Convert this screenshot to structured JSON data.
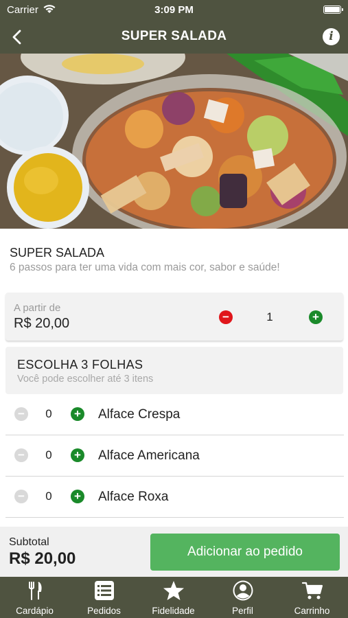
{
  "status_bar": {
    "carrier": "Carrier",
    "time": "3:09 PM"
  },
  "nav": {
    "title": "SUPER SALADA"
  },
  "product": {
    "name": "SUPER SALADA",
    "description": "6 passos para ter uma vida com mais cor, sabor e saúde!",
    "price_label": "A partir de",
    "price": "R$ 20,00",
    "quantity": "1"
  },
  "section": {
    "title": "ESCOLHA 3 FOLHAS",
    "subtitle": "Você pode escolher até 3 itens",
    "options": [
      {
        "label": "Alface Crespa",
        "qty": "0"
      },
      {
        "label": "Alface Americana",
        "qty": "0"
      },
      {
        "label": "Alface Roxa",
        "qty": "0"
      }
    ]
  },
  "footer": {
    "subtotal_label": "Subtotal",
    "subtotal_value": "R$ 20,00",
    "add_button": "Adicionar ao pedido"
  },
  "tabs": [
    {
      "label": "Cardápio",
      "icon": "fork-knife-icon"
    },
    {
      "label": "Pedidos",
      "icon": "list-icon"
    },
    {
      "label": "Fidelidade",
      "icon": "star-icon"
    },
    {
      "label": "Perfil",
      "icon": "profile-icon"
    },
    {
      "label": "Carrinho",
      "icon": "cart-icon"
    }
  ],
  "colors": {
    "bar": "#4f5340",
    "add_button": "#54b45f",
    "minus_active": "#e0161b",
    "plus": "#1a8a2a",
    "minus_disabled": "#d9d9d9"
  }
}
